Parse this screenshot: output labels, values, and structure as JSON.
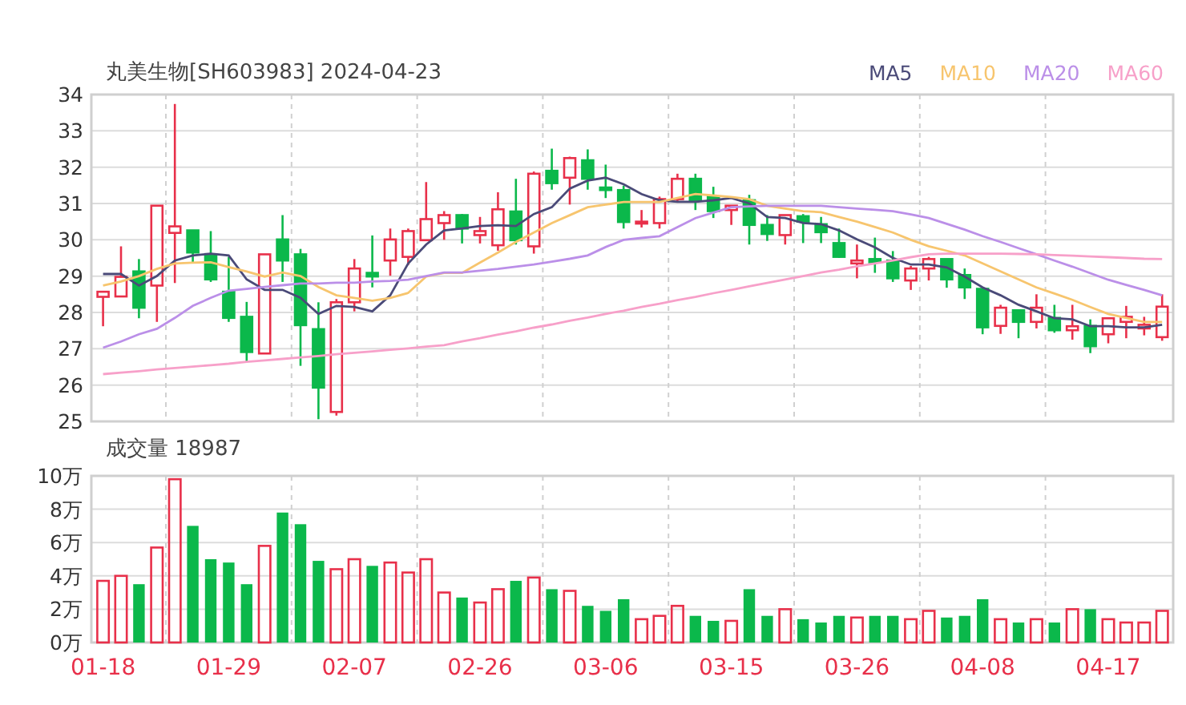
{
  "header": {
    "title": "丸美生物[SH603983] 2024-04-23"
  },
  "price_chart": {
    "chart_data": {
      "type": "candlestick",
      "grid": true,
      "ylim": [
        25,
        34
      ],
      "yticks": [
        25,
        26,
        27,
        28,
        29,
        30,
        31,
        32,
        33,
        34
      ],
      "categories": [
        null,
        null,
        null,
        null,
        null,
        null,
        null,
        null,
        null,
        null,
        null,
        null,
        null,
        null,
        null,
        null,
        null,
        null,
        null,
        null,
        null,
        null,
        null,
        null,
        null,
        null,
        null,
        null,
        null,
        null,
        null,
        null,
        null,
        null,
        null,
        null,
        null,
        null,
        null,
        null,
        null,
        null,
        null,
        null,
        null,
        null,
        null,
        null,
        null,
        null,
        null,
        null,
        null,
        null,
        null,
        null,
        null,
        null,
        null,
        null
      ],
      "ohlc": [
        [
          28.43,
          28.57,
          27.62,
          28.57
        ],
        [
          28.44,
          29.82,
          28.44,
          28.98
        ],
        [
          29.13,
          29.47,
          27.84,
          28.13
        ],
        [
          28.74,
          30.94,
          27.74,
          30.94
        ],
        [
          30.19,
          33.74,
          28.81,
          30.37
        ],
        [
          30.26,
          30.26,
          29.35,
          29.65
        ],
        [
          29.57,
          30.24,
          28.84,
          28.91
        ],
        [
          28.57,
          29.53,
          27.74,
          27.85
        ],
        [
          27.88,
          28.29,
          26.63,
          26.91
        ],
        [
          26.87,
          29.6,
          26.87,
          29.6
        ],
        [
          30.01,
          30.68,
          28.84,
          29.43
        ],
        [
          29.6,
          29.75,
          26.53,
          27.65
        ],
        [
          27.54,
          28.28,
          25.06,
          25.93
        ],
        [
          25.26,
          28.37,
          25.16,
          28.28
        ],
        [
          28.28,
          29.47,
          28.03,
          29.21
        ],
        [
          29.09,
          30.12,
          28.69,
          28.99
        ],
        [
          29.43,
          30.31,
          29.01,
          30.01
        ],
        [
          29.53,
          30.31,
          29.31,
          30.24
        ],
        [
          29.99,
          31.59,
          29.99,
          30.57
        ],
        [
          30.46,
          30.79,
          30.0,
          30.68
        ],
        [
          30.68,
          30.71,
          29.9,
          30.31
        ],
        [
          30.13,
          30.63,
          29.9,
          30.24
        ],
        [
          29.85,
          31.31,
          29.7,
          30.84
        ],
        [
          30.78,
          31.68,
          29.87,
          29.99
        ],
        [
          29.82,
          31.88,
          29.62,
          31.82
        ],
        [
          31.9,
          32.51,
          31.38,
          31.56
        ],
        [
          31.71,
          32.29,
          30.97,
          32.25
        ],
        [
          32.19,
          32.49,
          31.38,
          31.68
        ],
        [
          31.44,
          32.07,
          31.15,
          31.37
        ],
        [
          31.37,
          31.49,
          30.31,
          30.49
        ],
        [
          30.47,
          30.82,
          30.34,
          30.5
        ],
        [
          30.46,
          31.19,
          30.31,
          31.12
        ],
        [
          31.12,
          31.82,
          31.04,
          31.68
        ],
        [
          31.68,
          31.82,
          30.82,
          31.09
        ],
        [
          31.19,
          31.46,
          30.6,
          30.79
        ],
        [
          30.82,
          30.94,
          30.41,
          30.94
        ],
        [
          31.09,
          31.24,
          29.87,
          30.41
        ],
        [
          30.41,
          30.68,
          29.97,
          30.16
        ],
        [
          30.13,
          30.68,
          29.87,
          30.68
        ],
        [
          30.65,
          30.71,
          29.91,
          30.5
        ],
        [
          30.43,
          30.63,
          29.91,
          30.21
        ],
        [
          29.91,
          30.31,
          29.5,
          29.53
        ],
        [
          29.35,
          29.87,
          28.94,
          29.43
        ],
        [
          29.47,
          30.06,
          29.09,
          29.38
        ],
        [
          29.43,
          29.69,
          28.84,
          28.94
        ],
        [
          28.88,
          29.28,
          28.62,
          29.21
        ],
        [
          29.21,
          29.53,
          28.88,
          29.47
        ],
        [
          29.47,
          29.47,
          28.68,
          28.91
        ],
        [
          29.03,
          29.21,
          28.37,
          28.69
        ],
        [
          28.65,
          28.65,
          27.4,
          27.59
        ],
        [
          27.63,
          28.21,
          27.41,
          28.13
        ],
        [
          28.06,
          28.06,
          27.29,
          27.74
        ],
        [
          27.74,
          28.5,
          27.56,
          28.13
        ],
        [
          27.85,
          28.21,
          27.44,
          27.51
        ],
        [
          27.51,
          28.21,
          27.25,
          27.62
        ],
        [
          27.63,
          27.81,
          26.88,
          27.07
        ],
        [
          27.4,
          27.84,
          27.15,
          27.84
        ],
        [
          27.74,
          28.18,
          27.29,
          27.88
        ],
        [
          27.56,
          27.88,
          27.37,
          27.66
        ],
        [
          27.32,
          28.5,
          27.22,
          28.16
        ]
      ],
      "series": [
        {
          "name": "MA5",
          "type": "line",
          "color": "#4a4a78",
          "values": [
            29.06,
            29.06,
            28.74,
            29.0,
            29.43,
            29.57,
            29.62,
            29.57,
            28.91,
            28.62,
            28.62,
            28.4,
            27.96,
            28.18,
            28.15,
            28.03,
            28.47,
            29.35,
            29.87,
            30.26,
            30.31,
            30.38,
            30.4,
            30.38,
            30.71,
            30.9,
            31.41,
            31.63,
            31.71,
            31.53,
            31.26,
            31.09,
            31.05,
            31.05,
            31.09,
            31.15,
            31.0,
            30.63,
            30.6,
            30.46,
            30.43,
            30.26,
            30.01,
            29.79,
            29.5,
            29.32,
            29.32,
            29.24,
            28.99,
            28.69,
            28.47,
            28.21,
            28.03,
            27.84,
            27.81,
            27.62,
            27.62,
            27.59,
            27.59,
            27.66
          ]
        },
        {
          "name": "MA10",
          "type": "line",
          "color": "#f7c56e",
          "values": [
            28.74,
            28.85,
            29.0,
            29.2,
            29.35,
            29.37,
            29.38,
            29.25,
            29.13,
            28.99,
            29.1,
            29.0,
            28.7,
            28.47,
            28.4,
            28.32,
            28.4,
            28.54,
            28.99,
            29.09,
            29.09,
            29.37,
            29.65,
            29.94,
            30.2,
            30.46,
            30.68,
            30.9,
            30.97,
            31.04,
            31.04,
            31.04,
            31.15,
            31.26,
            31.22,
            31.18,
            31.12,
            30.94,
            30.86,
            30.79,
            30.76,
            30.63,
            30.5,
            30.35,
            30.2,
            30.0,
            29.82,
            29.7,
            29.57,
            29.35,
            29.13,
            28.91,
            28.69,
            28.52,
            28.35,
            28.15,
            27.96,
            27.85,
            27.74,
            27.74
          ]
        },
        {
          "name": "MA20",
          "type": "line",
          "color": "#bb8fe8",
          "values": [
            27.03,
            27.2,
            27.4,
            27.55,
            27.85,
            28.18,
            28.4,
            28.6,
            28.65,
            28.7,
            28.75,
            28.8,
            28.8,
            28.82,
            28.82,
            28.85,
            28.87,
            28.9,
            29.0,
            29.1,
            29.1,
            29.15,
            29.2,
            29.26,
            29.32,
            29.4,
            29.48,
            29.57,
            29.8,
            30.0,
            30.05,
            30.1,
            30.35,
            30.6,
            30.75,
            30.9,
            30.92,
            30.94,
            30.94,
            30.94,
            30.94,
            30.9,
            30.86,
            30.83,
            30.79,
            30.7,
            30.6,
            30.44,
            30.28,
            30.1,
            29.94,
            29.77,
            29.6,
            29.43,
            29.26,
            29.08,
            28.9,
            28.76,
            28.62,
            28.47
          ]
        },
        {
          "name": "MA60",
          "type": "line",
          "color": "#f7a0c9",
          "values": [
            26.3,
            26.34,
            26.38,
            26.43,
            26.47,
            26.51,
            26.55,
            26.59,
            26.64,
            26.68,
            26.72,
            26.76,
            26.8,
            26.85,
            26.89,
            26.93,
            26.97,
            27.01,
            27.06,
            27.1,
            27.2,
            27.29,
            27.39,
            27.48,
            27.58,
            27.67,
            27.77,
            27.86,
            27.96,
            28.05,
            28.15,
            28.24,
            28.34,
            28.43,
            28.53,
            28.62,
            28.72,
            28.81,
            28.91,
            29.0,
            29.1,
            29.18,
            29.27,
            29.35,
            29.43,
            29.52,
            29.6,
            29.62,
            29.62,
            29.62,
            29.62,
            29.61,
            29.6,
            29.58,
            29.56,
            29.54,
            29.52,
            29.5,
            29.48,
            29.47
          ]
        }
      ]
    }
  },
  "volume_chart": {
    "label": "成交量 18987",
    "chart_data": {
      "type": "bar",
      "stacked": true,
      "grid": true,
      "ylim": [
        0,
        10
      ],
      "categories": [
        "01-18",
        null,
        null,
        null,
        null,
        null,
        null,
        "01-29",
        null,
        null,
        null,
        null,
        null,
        null,
        "02-07",
        null,
        null,
        null,
        null,
        null,
        null,
        "02-26",
        null,
        null,
        null,
        null,
        null,
        null,
        "03-06",
        null,
        null,
        null,
        null,
        null,
        null,
        "03-15",
        null,
        null,
        null,
        null,
        null,
        null,
        "03-26",
        null,
        null,
        null,
        null,
        null,
        null,
        "04-08",
        null,
        null,
        null,
        null,
        null,
        null,
        "04-17",
        null,
        null,
        null
      ],
      "yticks": [
        {
          "value": 0,
          "label": "0万"
        },
        {
          "value": 2,
          "label": "2万"
        },
        {
          "value": 4,
          "label": "4万"
        },
        {
          "value": 6,
          "label": "6万"
        },
        {
          "value": 8,
          "label": "8万"
        },
        {
          "value": 10,
          "label": "10万"
        }
      ],
      "series": [
        {
          "color": "#e8304a",
          "values": [
            3.7,
            4.0,
            null,
            5.7,
            9.8,
            null,
            null,
            null,
            null,
            5.8,
            null,
            null,
            null,
            4.4,
            5.0,
            null,
            4.8,
            4.2,
            5.0,
            3.0,
            null,
            2.4,
            3.2,
            null,
            3.9,
            null,
            3.1,
            null,
            null,
            null,
            1.4,
            1.6,
            2.2,
            null,
            null,
            1.3,
            null,
            null,
            2.0,
            null,
            null,
            null,
            1.5,
            null,
            null,
            1.4,
            1.9,
            null,
            null,
            null,
            1.4,
            null,
            1.4,
            null,
            2.0,
            null,
            1.4,
            1.2,
            1.2,
            1.9
          ]
        },
        {
          "color": "#0bb84b",
          "values": [
            null,
            null,
            3.5,
            null,
            null,
            7.0,
            5.0,
            4.8,
            3.5,
            null,
            7.8,
            7.1,
            4.9,
            null,
            null,
            4.6,
            null,
            null,
            null,
            null,
            2.7,
            null,
            null,
            3.7,
            null,
            3.2,
            null,
            2.2,
            1.9,
            2.6,
            null,
            null,
            null,
            1.6,
            1.3,
            null,
            3.2,
            1.6,
            null,
            1.4,
            1.2,
            1.6,
            null,
            1.6,
            1.6,
            null,
            null,
            1.5,
            1.6,
            2.6,
            null,
            1.2,
            null,
            1.2,
            null,
            2.0,
            null,
            null,
            null,
            null
          ]
        }
      ]
    }
  }
}
